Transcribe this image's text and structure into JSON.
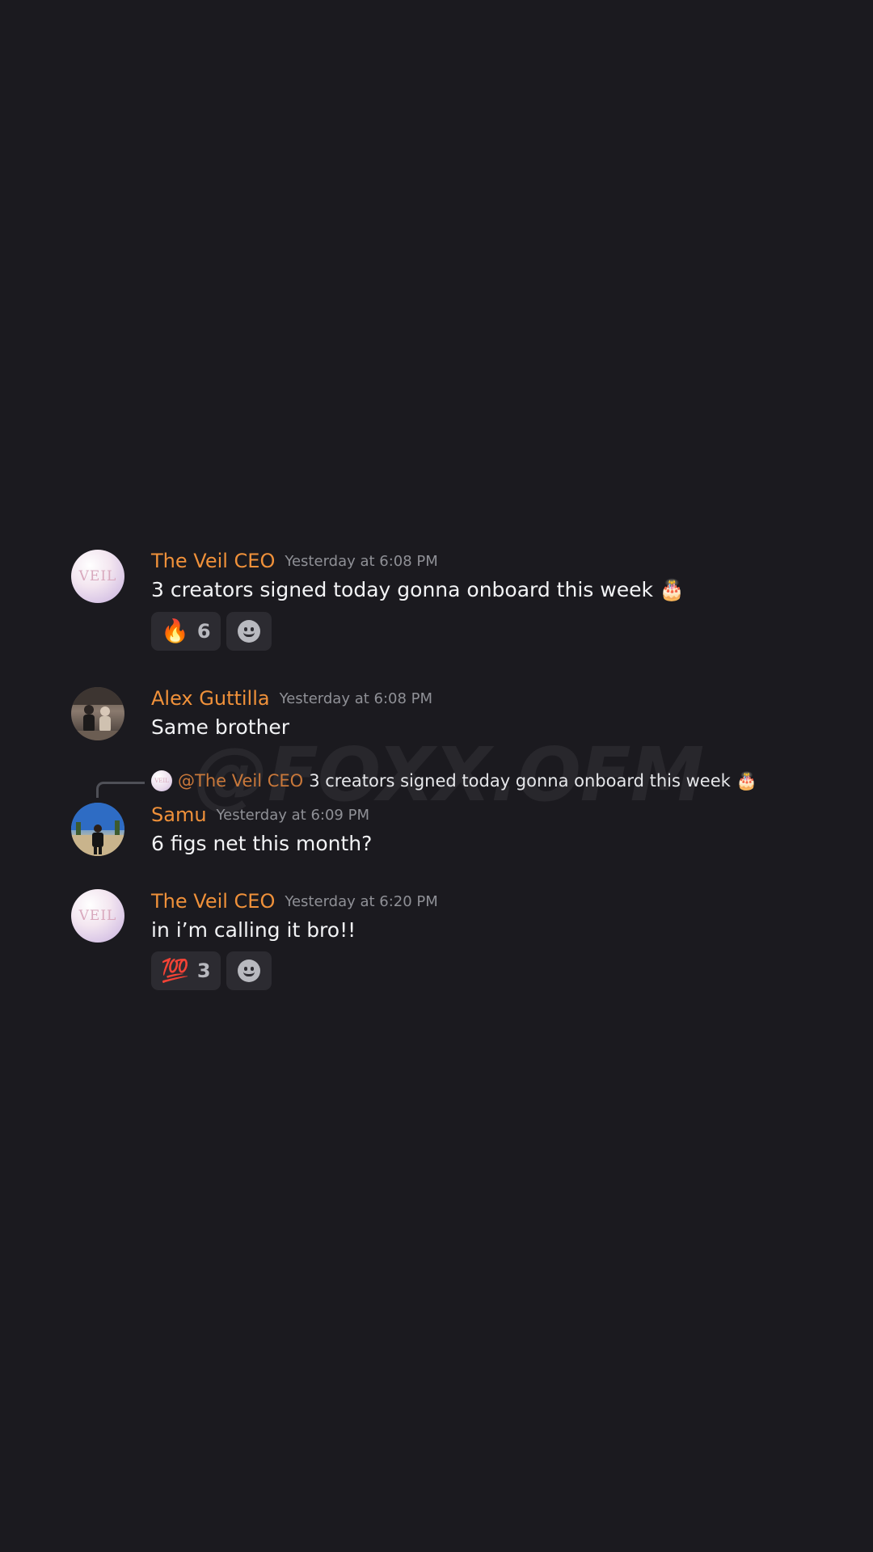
{
  "watermark": "@FOXX.OFM",
  "messages": [
    {
      "author": "The Veil CEO",
      "timestamp": "Yesterday at 6:08 PM",
      "text": "3 creators signed today gonna onboard this week 🎂",
      "reactions": [
        {
          "emoji": "🔥",
          "count": "6"
        }
      ]
    },
    {
      "author": "Alex Guttilla",
      "timestamp": "Yesterday at 6:08 PM",
      "text": "Same brother"
    },
    {
      "reply_to": {
        "mention": "@The Veil CEO",
        "text": "3 creators signed today gonna onboard this week 🎂"
      },
      "author": "Samu",
      "timestamp": "Yesterday at 6:09 PM",
      "text": "6 figs net this month?"
    },
    {
      "author": "The Veil CEO",
      "timestamp": "Yesterday at 6:20 PM",
      "text": "in i’m calling it bro!!",
      "reactions": [
        {
          "emoji": "💯",
          "count": "3"
        }
      ]
    }
  ],
  "avatar_logo_text": "VEIL",
  "colors": {
    "background": "#1b1a1f",
    "username": "#f0913a",
    "timestamp": "#8f9096",
    "reaction_bg": "#2c2b31"
  },
  "icons": {
    "add_reaction": "smile-icon"
  }
}
